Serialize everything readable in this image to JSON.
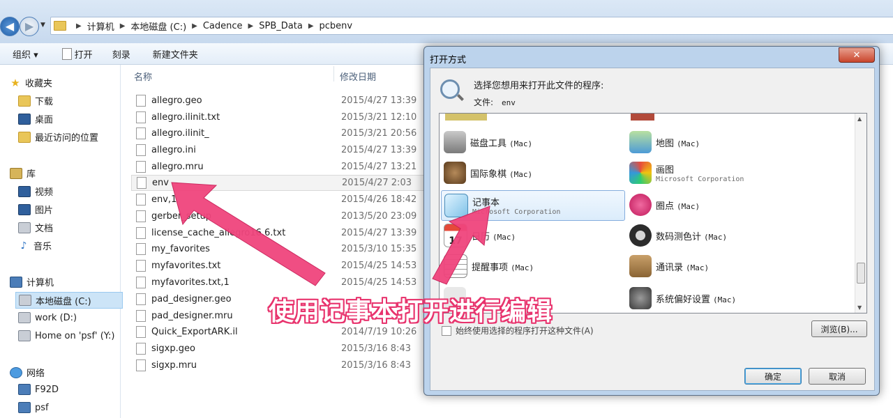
{
  "address_bar": {
    "back_glyph": "◀",
    "forward_glyph": "▶",
    "breadcrumbs": [
      "计算机",
      "本地磁盘 (C:)",
      "Cadence",
      "SPB_Data",
      "pcbenv"
    ]
  },
  "toolbar": {
    "organize": "组织 ▾",
    "open": "打开",
    "burn": "刻录",
    "new_folder": "新建文件夹"
  },
  "nav": {
    "favorites": "收藏夹",
    "downloads": "下载",
    "desktop": "桌面",
    "recent": "最近访问的位置",
    "libraries": "库",
    "videos": "视频",
    "pictures": "图片",
    "documents": "文档",
    "music": "音乐",
    "computer": "计算机",
    "local_disk": "本地磁盘 (C:)",
    "work": "work (D:)",
    "home": "Home on 'psf' (Y:)",
    "network": "网络",
    "net1": "F92D",
    "net2": "psf"
  },
  "file_list": {
    "headers": {
      "name": "名称",
      "date": "修改日期"
    },
    "rows": [
      {
        "name": "allegro.geo",
        "date": "2015/4/27 13:39"
      },
      {
        "name": "allegro.ilinit.txt",
        "date": "2015/3/21 12:10"
      },
      {
        "name": "allegro.ilinit_",
        "date": "2015/3/21 20:56"
      },
      {
        "name": "allegro.ini",
        "date": "2015/4/27 13:39"
      },
      {
        "name": "allegro.mru",
        "date": "2015/4/27 13:21"
      },
      {
        "name": "env",
        "date": "2015/4/27 2:03"
      },
      {
        "name": "env,1",
        "date": "2015/4/26 18:42"
      },
      {
        "name": "gerber_setup",
        "date": "2013/5/20 23:09"
      },
      {
        "name": "license_cache_allegro16.6.txt",
        "date": "2015/4/27 13:39"
      },
      {
        "name": "my_favorites",
        "date": "2015/3/10 15:35"
      },
      {
        "name": "myfavorites.txt",
        "date": "2015/4/25 14:53"
      },
      {
        "name": "myfavorites.txt,1",
        "date": "2015/4/25 14:53"
      },
      {
        "name": "pad_designer.geo",
        "date": ""
      },
      {
        "name": "pad_designer.mru",
        "date": ""
      },
      {
        "name": "Quick_ExportARK.il",
        "date": "2014/7/19 10:26"
      },
      {
        "name": "sigxp.geo",
        "date": "2015/3/16 8:43"
      },
      {
        "name": "sigxp.mru",
        "date": "2015/3/16 8:43"
      }
    ]
  },
  "dialog": {
    "title": "打开方式",
    "close_glyph": "✕",
    "prompt": "选择您想用来打开此文件的程序:",
    "file_label": "文件:",
    "file_name": "env",
    "programs": [
      {
        "name": "磁盘工具",
        "sub": "(Mac)"
      },
      {
        "name": "地图",
        "sub": "(Mac)"
      },
      {
        "name": "国际象棋",
        "sub": "(Mac)"
      },
      {
        "name": "画图",
        "sub": "Microsoft Corporation"
      },
      {
        "name": "记事本",
        "sub": "Microsoft Corporation"
      },
      {
        "name": "圈点",
        "sub": "(Mac)"
      },
      {
        "name": "日历",
        "sub": "(Mac)"
      },
      {
        "name": "数码测色计",
        "sub": "(Mac)"
      },
      {
        "name": "提醒事项",
        "sub": "(Mac)"
      },
      {
        "name": "通讯录",
        "sub": "(Mac)"
      },
      {
        "name": "",
        "sub": ""
      },
      {
        "name": "系统偏好设置",
        "sub": "(Mac)"
      }
    ],
    "always_use": "始终使用选择的程序打开这种文件(A)",
    "browse": "浏览(B)...",
    "ok": "确定",
    "cancel": "取消"
  },
  "annotation": {
    "text": "使用记事本打开进行编辑",
    "color": "#e8336d"
  }
}
